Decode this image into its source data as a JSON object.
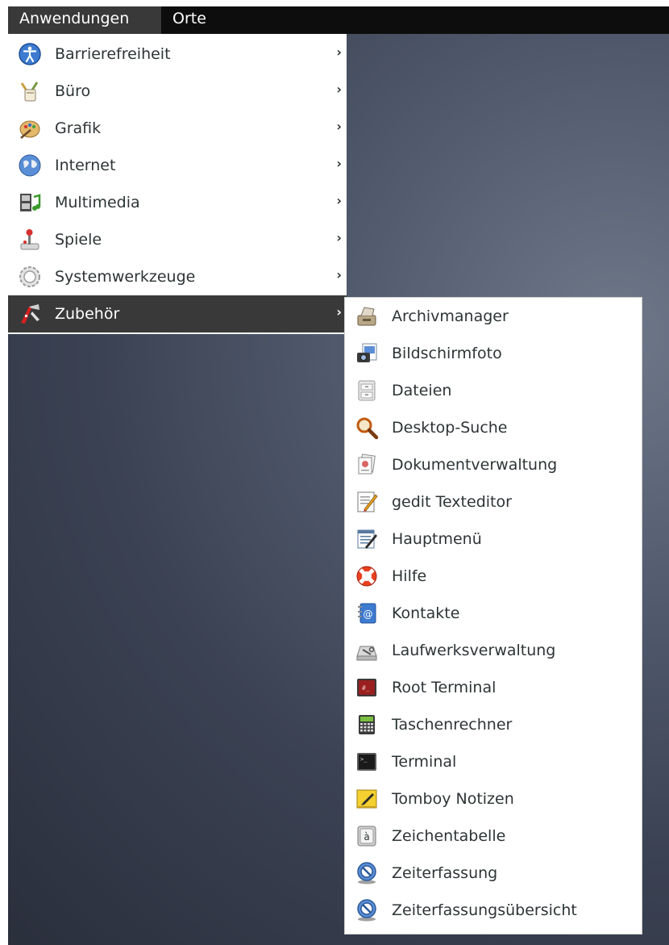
{
  "topbar": {
    "apps_label": "Anwendungen",
    "places_label": "Orte"
  },
  "main_menu": {
    "items": [
      {
        "label": "Barrierefreiheit",
        "icon": "accessibility-icon",
        "active": false
      },
      {
        "label": "Büro",
        "icon": "office-icon",
        "active": false
      },
      {
        "label": "Grafik",
        "icon": "graphics-icon",
        "active": false
      },
      {
        "label": "Internet",
        "icon": "internet-globe-icon",
        "active": false
      },
      {
        "label": "Multimedia",
        "icon": "multimedia-icon",
        "active": false
      },
      {
        "label": "Spiele",
        "icon": "games-joystick-icon",
        "active": false
      },
      {
        "label": "Systemwerkzeuge",
        "icon": "system-tools-gear-icon",
        "active": false
      },
      {
        "label": "Zubehör",
        "icon": "accessories-knife-icon",
        "active": true
      }
    ],
    "arrow": "›"
  },
  "sub_menu": {
    "items": [
      {
        "label": "Archivmanager",
        "icon": "archive-manager-icon"
      },
      {
        "label": "Bildschirmfoto",
        "icon": "screenshot-camera-icon"
      },
      {
        "label": "Dateien",
        "icon": "file-cabinet-icon"
      },
      {
        "label": "Desktop-Suche",
        "icon": "magnifier-icon"
      },
      {
        "label": "Dokumentverwaltung",
        "icon": "document-manager-icon"
      },
      {
        "label": "gedit Texteditor",
        "icon": "text-editor-icon"
      },
      {
        "label": "Hauptmenü",
        "icon": "main-menu-editor-icon"
      },
      {
        "label": "Hilfe",
        "icon": "help-lifebuoy-icon"
      },
      {
        "label": "Kontakte",
        "icon": "contacts-book-icon"
      },
      {
        "label": "Laufwerksverwaltung",
        "icon": "disk-utility-icon"
      },
      {
        "label": "Root Terminal",
        "icon": "root-terminal-icon"
      },
      {
        "label": "Taschenrechner",
        "icon": "calculator-icon"
      },
      {
        "label": "Terminal",
        "icon": "terminal-icon"
      },
      {
        "label": "Tomboy Notizen",
        "icon": "tomboy-notes-icon"
      },
      {
        "label": "Zeichentabelle",
        "icon": "character-map-icon"
      },
      {
        "label": "Zeiterfassung",
        "icon": "time-tracker-icon"
      },
      {
        "label": "Zeiterfassungsübersicht",
        "icon": "time-tracker-overview-icon"
      }
    ]
  }
}
